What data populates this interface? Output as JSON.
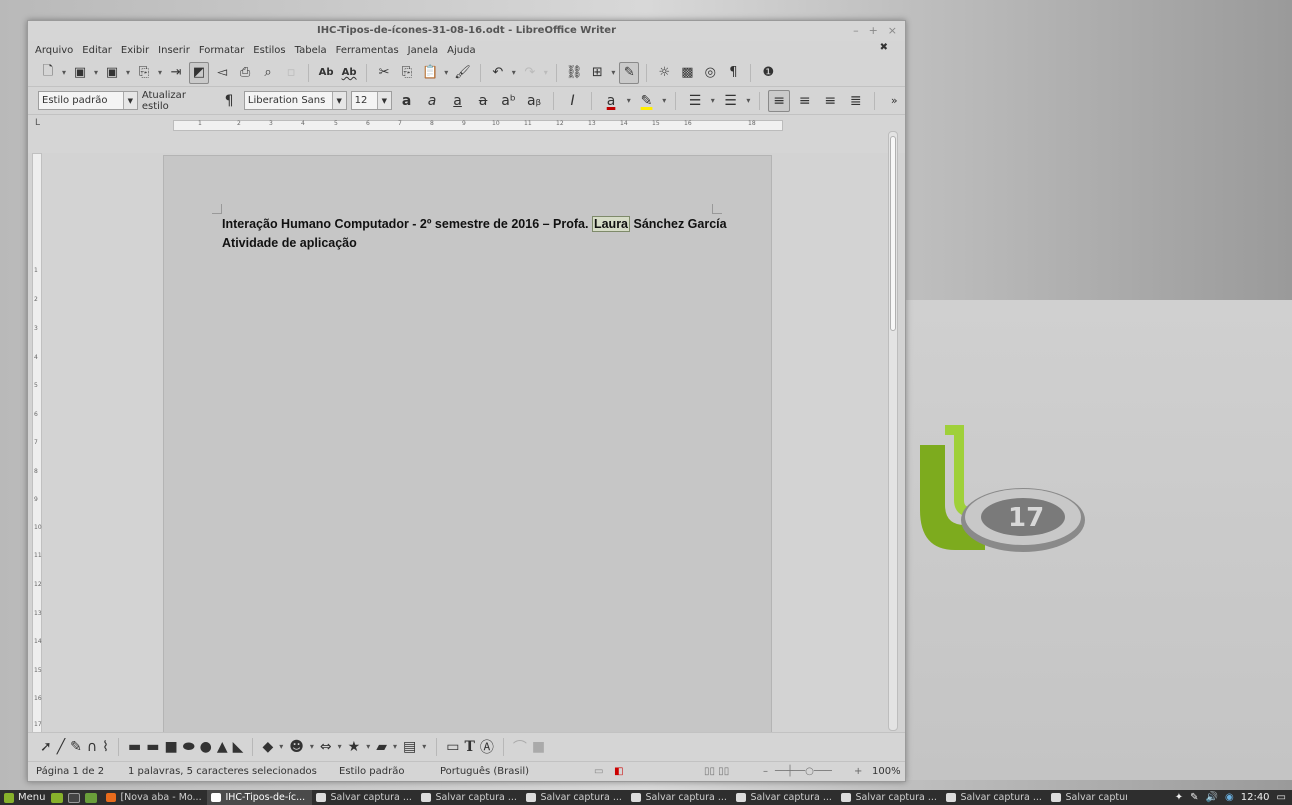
{
  "window": {
    "title": "IHC-Tipos-de-ícones-31-08-16.odt - LibreOffice Writer",
    "controls": {
      "minimize": "–",
      "maximize": "+",
      "close": "×"
    },
    "doc_close": "✖"
  },
  "menubar": [
    "Arquivo",
    "Editar",
    "Exibir",
    "Inserir",
    "Formatar",
    "Estilos",
    "Tabela",
    "Ferramentas",
    "Janela",
    "Ajuda"
  ],
  "formatting": {
    "paragraph_style": "Estilo padrão",
    "update_style": "Atualizar estilo",
    "font_name": "Liberation Sans",
    "font_size": "12",
    "more": "»"
  },
  "ruler": {
    "corner": "L",
    "marks": [
      "1",
      "2",
      "3",
      "4",
      "5",
      "6",
      "7",
      "8",
      "9",
      "10",
      "11",
      "12",
      "13",
      "14",
      "15",
      "16",
      "18"
    ]
  },
  "vruler_marks": [
    "1",
    "2",
    "3",
    "4",
    "5",
    "6",
    "7",
    "8",
    "9",
    "10",
    "11",
    "12",
    "13",
    "14",
    "15",
    "16",
    "17"
  ],
  "document": {
    "line1_before": "Interação Humano Computador - 2º semestre de 2016 – Profa. ",
    "line1_selected": "Laura",
    "line1_after": " Sánchez García",
    "line2": "Atividade de aplicação"
  },
  "statusbar": {
    "page": "Página 1 de 2",
    "words": "1 palavras, 5 caracteres selecionados",
    "style": "Estilo padrão",
    "language": "Português (Brasil)",
    "zoom_minus": "–",
    "zoom_plus": "+",
    "zoom": "100%"
  },
  "taskbar": {
    "menu_label": "Menu",
    "tasks": [
      {
        "label": "[Nova aba - Mo...",
        "active": false
      },
      {
        "label": "IHC-Tipos-de-íc...",
        "active": true
      },
      {
        "label": "Salvar captura ...",
        "active": false
      },
      {
        "label": "Salvar captura ...",
        "active": false
      },
      {
        "label": "Salvar captura ...",
        "active": false
      },
      {
        "label": "Salvar captura ...",
        "active": false
      },
      {
        "label": "Salvar captura ...",
        "active": false
      },
      {
        "label": "Salvar captura ...",
        "active": false
      },
      {
        "label": "Salvar captura ...",
        "active": false
      },
      {
        "label": "Salvar captura ...",
        "active": false
      }
    ],
    "clock": "12:40"
  },
  "colors": {
    "font_color_underline": "#c00000",
    "highlight_underline": "#ffee00",
    "mint_green": "#87b12b",
    "taskbar_bg": "#2e2e2e"
  }
}
